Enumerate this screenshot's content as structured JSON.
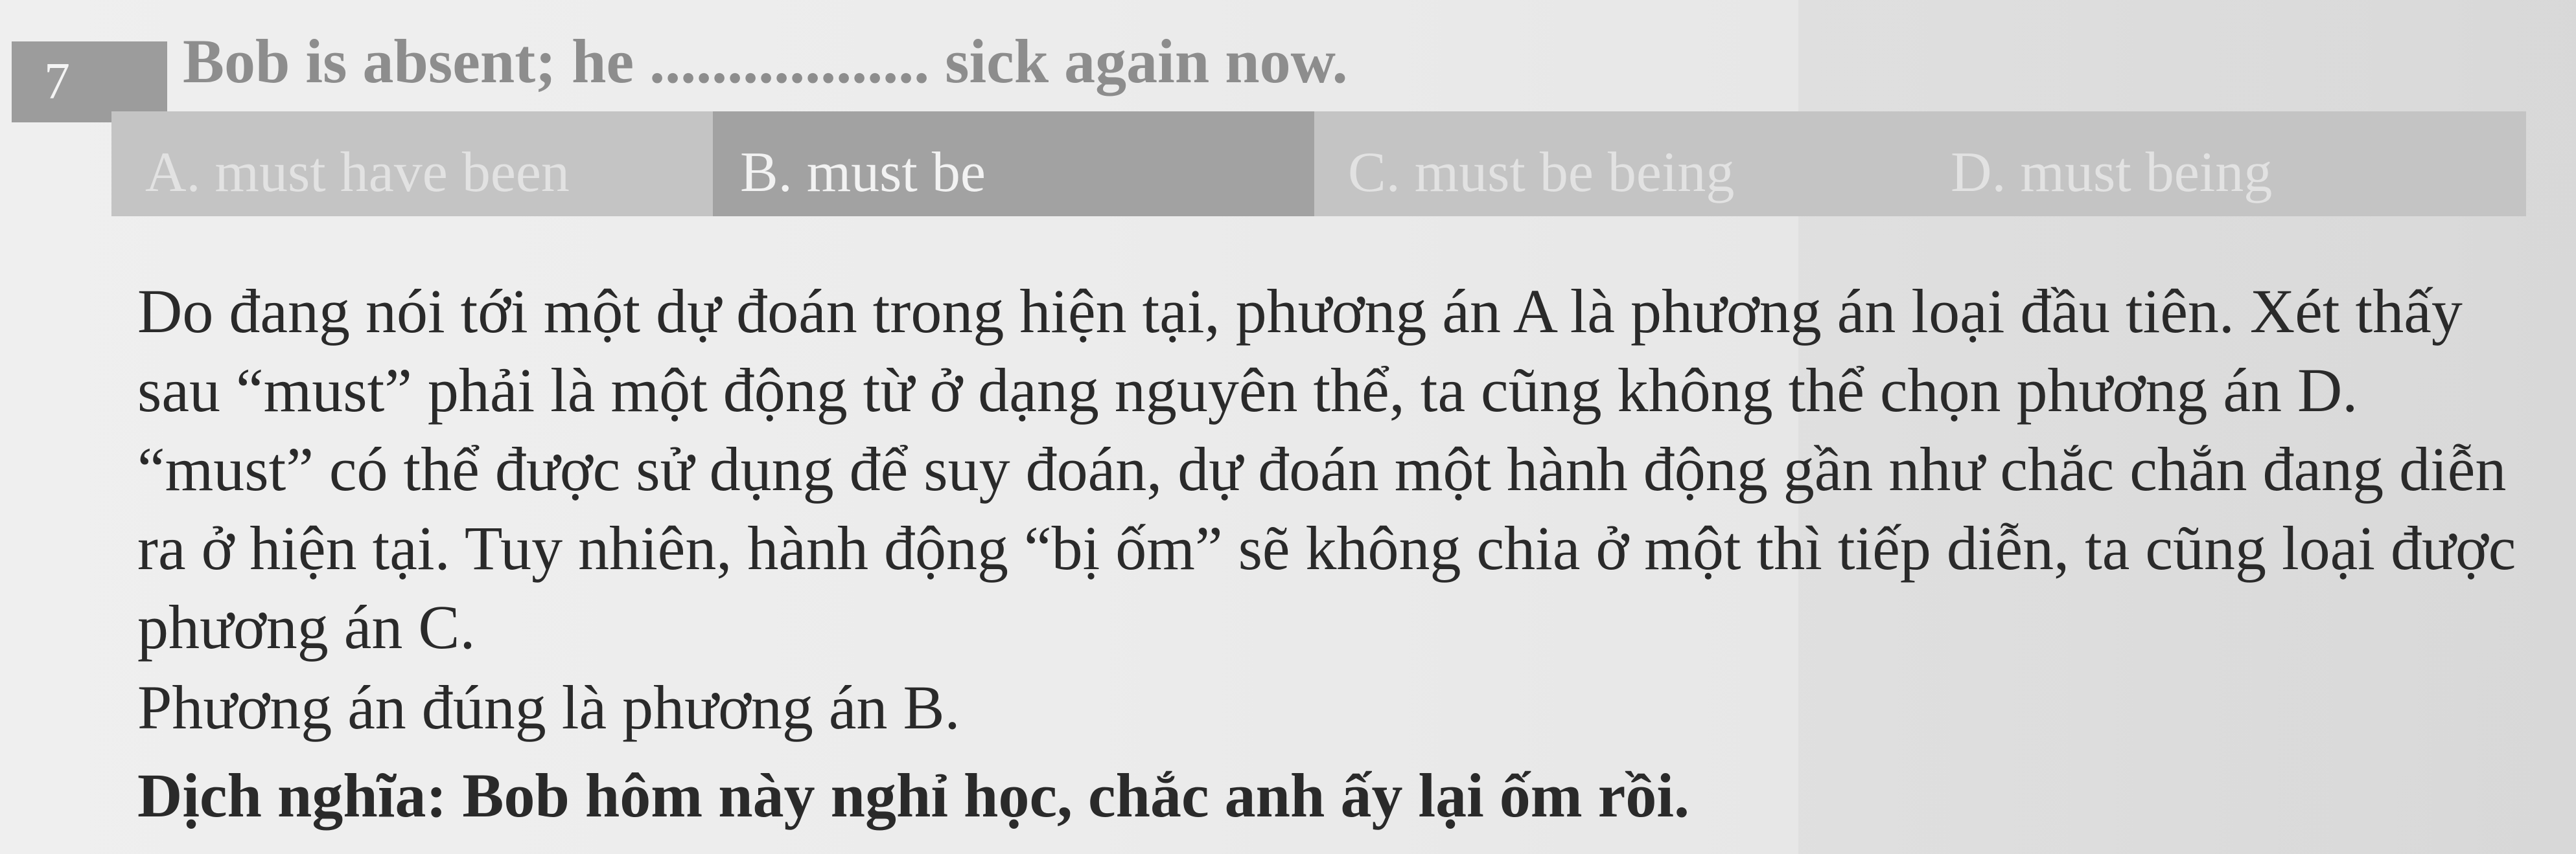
{
  "question": {
    "number": "7",
    "text": "Bob is absent; he .................. sick again now."
  },
  "options": [
    {
      "label": "A. must have been",
      "selected": false
    },
    {
      "label": "B. must be",
      "selected": true
    },
    {
      "label": "C. must be being",
      "selected": false
    },
    {
      "label": "D. must being",
      "selected": false
    }
  ],
  "explanation": {
    "paragraph": "Do đang nói tới một dự đoán trong hiện tại, phương án A là phương án loại đầu tiên. Xét thấy sau “must” phải là một động từ ở dạng nguyên thể, ta cũng không thể chọn phương án D. “must” có thể được sử dụng để suy đoán, dự đoán một hành động gần như chắc chắn đang diễn ra ở hiện tại. Tuy nhiên, hành động “bị ốm” sẽ không chia ở một thì tiếp diễn, ta cũng loại được phương án C.",
    "answer": "Phương án đúng là phương án B.",
    "translation": "Dịch nghĩa: Bob hôm này nghỉ học, chắc anh ấy lại ốm rồi."
  },
  "colors": {
    "badge": "#9c9c9c",
    "selected_option": "#a2a2a2",
    "option_bar": "#c4c4c4",
    "body_text": "#2a2a2a"
  }
}
